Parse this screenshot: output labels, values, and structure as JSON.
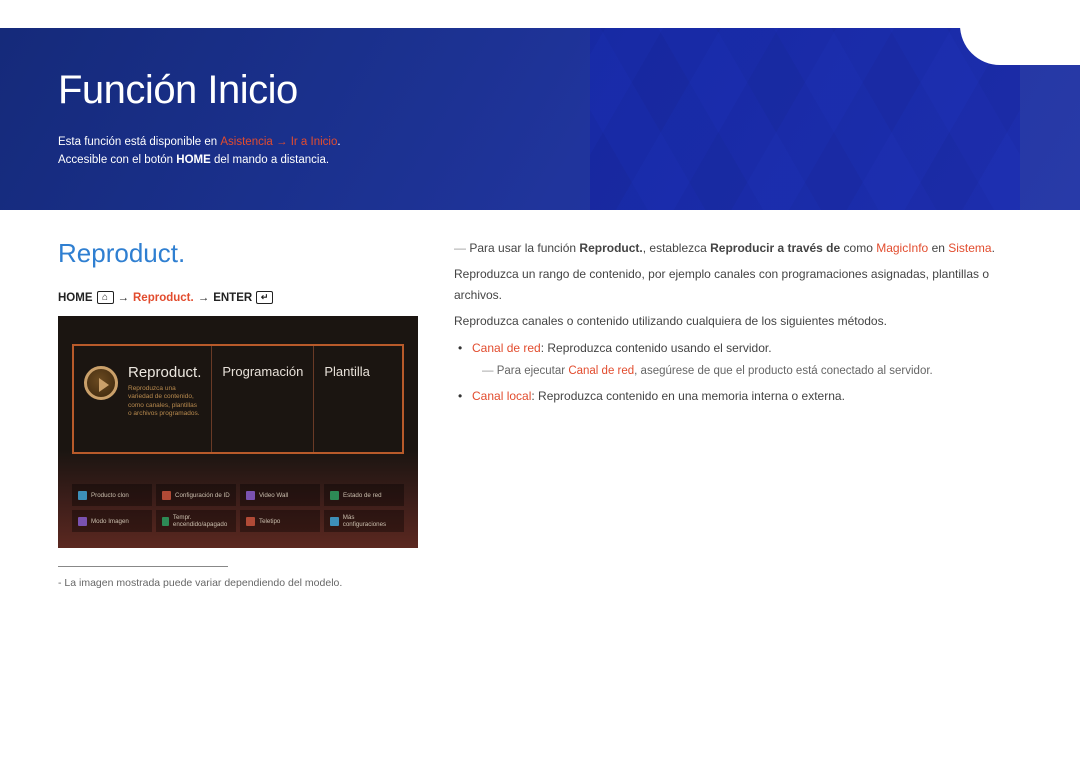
{
  "hero": {
    "title": "Función Inicio",
    "line1_pre": "Esta función está disponible en ",
    "line1_link": "Asistencia → Ir a Inicio",
    "line1_post": ".",
    "line2_pre": "Accesible con el botón ",
    "line2_bold": "HOME",
    "line2_post": " del mando a distancia."
  },
  "section": {
    "title": "Reproduct.",
    "nav_home": "HOME",
    "nav_arrow1": " → ",
    "nav_mid": "Reproduct.",
    "nav_arrow2": " →",
    "nav_enter": "ENTER"
  },
  "tvshot": {
    "tile_big_title": "Reproduct.",
    "tile_big_sub": "Reproduzca una variedad de contenido, como canales, plantillas o archivos programados.",
    "tile2": "Programación",
    "tile3": "Plantilla",
    "buttons": [
      {
        "icon": "#3d8fb8",
        "label": "Producto clon"
      },
      {
        "icon": "#b04a36",
        "label": "Configuración de ID"
      },
      {
        "icon": "#7a52b0",
        "label": "Video Wall"
      },
      {
        "icon": "#2d8a55",
        "label": "Estado de red"
      },
      {
        "icon": "#7a52b0",
        "label": "Modo Imagen"
      },
      {
        "icon": "#2d8a55",
        "label": "Tempr. encendido/apagado"
      },
      {
        "icon": "#b04a36",
        "label": "Teletipo"
      },
      {
        "icon": "#3d8fb8",
        "label": "Más configuraciones"
      }
    ]
  },
  "footnote": "La imagen mostrada puede variar dependiendo del modelo.",
  "right": {
    "p1_pre": "Para usar la función ",
    "p1_b1": "Reproduct.",
    "p1_mid1": ", establezca ",
    "p1_b2": "Reproducir a través de",
    "p1_mid2": " como ",
    "p1_b3": "MagicInfo",
    "p1_mid3": " en ",
    "p1_b4": "Sistema",
    "p1_end": ".",
    "p2": "Reproduzca un rango de contenido, por ejemplo canales con programaciones asignadas, plantillas o archivos.",
    "p3": "Reproduzca canales o contenido utilizando cualquiera de los siguientes métodos.",
    "b1_key": "Canal de red",
    "b1_txt": ": Reproduzca contenido usando el servidor.",
    "b1_note_pre": "Para ejecutar ",
    "b1_note_key": "Canal de red",
    "b1_note_post": ", asegúrese de que el producto está conectado al servidor.",
    "b2_key": "Canal local",
    "b2_txt": ": Reproduzca contenido en una memoria interna o externa."
  }
}
